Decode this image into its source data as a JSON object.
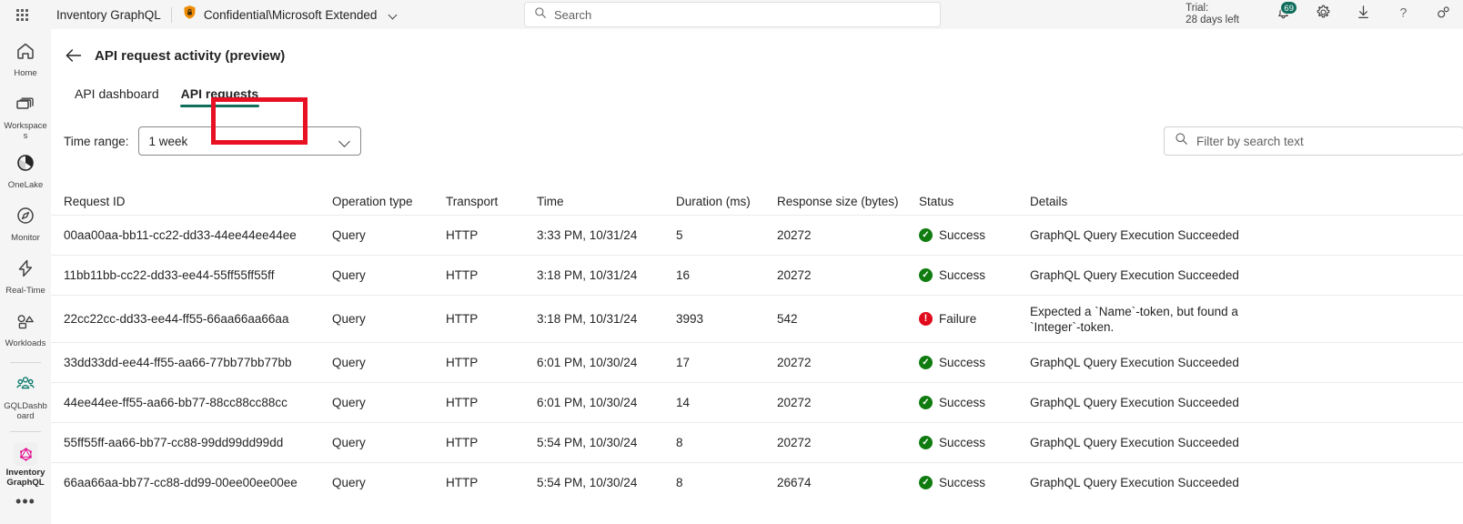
{
  "suitebar": {
    "waffle_label": "App launcher",
    "product_title": "Inventory GraphQL",
    "sensitivity_label": "Confidential\\Microsoft Extended",
    "search_placeholder": "Search",
    "search_value": "",
    "trial_line1": "Trial:",
    "trial_line2": "28 days left",
    "notification_badge": "69",
    "icons": {
      "waffle": "app-launcher-icon",
      "sensitivity": "shield-lock-icon",
      "search": "search-icon",
      "notifications": "notification-bell-icon",
      "settings": "gear-icon",
      "downloads": "download-icon",
      "help": "help-icon",
      "feedback": "feedback-icon"
    }
  },
  "rail": {
    "items": [
      {
        "label": "Home",
        "icon": "home-icon",
        "active": false
      },
      {
        "label": "Workspaces",
        "icon": "workspaces-icon",
        "active": false
      },
      {
        "label": "OneLake",
        "icon": "onelake-icon",
        "active": false
      },
      {
        "label": "Monitor",
        "icon": "monitor-icon",
        "active": false
      },
      {
        "label": "Real-Time",
        "icon": "real-time-icon",
        "active": false
      },
      {
        "label": "Workloads",
        "icon": "workloads-icon",
        "active": false
      },
      {
        "label": "GQLDashboard",
        "icon": "people-group-icon",
        "active": false
      },
      {
        "label": "Inventory GraphQL",
        "icon": "graphql-icon",
        "active": true
      }
    ],
    "more_label": "•••"
  },
  "page": {
    "back_label": "Back",
    "title": "API request activity (preview)",
    "tabs": [
      {
        "label": "API dashboard",
        "selected": false
      },
      {
        "label": "API requests",
        "selected": true
      }
    ],
    "annotation_color": "#e81123",
    "accent_color": "#0f6e5c"
  },
  "filters": {
    "time_range_label": "Time range:",
    "time_range_value": "1 week",
    "filter_placeholder": "Filter by search text",
    "filter_value": ""
  },
  "table": {
    "columns": [
      "Request ID",
      "Operation type",
      "Transport",
      "Time",
      "Duration (ms)",
      "Response size (bytes)",
      "Status",
      "Details"
    ],
    "rows": [
      {
        "request_id": "00aa00aa-bb11-cc22-dd33-44ee44ee44ee",
        "operation_type": "Query",
        "transport": "HTTP",
        "time": "3:33 PM, 10/31/24",
        "duration": "5",
        "response_size": "20272",
        "status": "Success",
        "status_kind": "success",
        "details": "GraphQL Query Execution Succeeded"
      },
      {
        "request_id": "11bb11bb-cc22-dd33-ee44-55ff55ff55ff",
        "operation_type": "Query",
        "transport": "HTTP",
        "time": "3:18 PM, 10/31/24",
        "duration": "16",
        "response_size": "20272",
        "status": "Success",
        "status_kind": "success",
        "details": "GraphQL Query Execution Succeeded"
      },
      {
        "request_id": "22cc22cc-dd33-ee44-ff55-66aa66aa66aa",
        "operation_type": "Query",
        "transport": "HTTP",
        "time": "3:18 PM, 10/31/24",
        "duration": "3993",
        "response_size": "542",
        "status": "Failure",
        "status_kind": "failure",
        "details": "Expected a `Name`-token, but found a `Integer`-token."
      },
      {
        "request_id": "33dd33dd-ee44-ff55-aa66-77bb77bb77bb",
        "operation_type": "Query",
        "transport": "HTTP",
        "time": "6:01 PM, 10/30/24",
        "duration": "17",
        "response_size": "20272",
        "status": "Success",
        "status_kind": "success",
        "details": "GraphQL Query Execution Succeeded"
      },
      {
        "request_id": "44ee44ee-ff55-aa66-bb77-88cc88cc88cc",
        "operation_type": "Query",
        "transport": "HTTP",
        "time": "6:01 PM, 10/30/24",
        "duration": "14",
        "response_size": "20272",
        "status": "Success",
        "status_kind": "success",
        "details": "GraphQL Query Execution Succeeded"
      },
      {
        "request_id": "55ff55ff-aa66-bb77-cc88-99dd99dd99dd",
        "operation_type": "Query",
        "transport": "HTTP",
        "time": "5:54 PM, 10/30/24",
        "duration": "8",
        "response_size": "20272",
        "status": "Success",
        "status_kind": "success",
        "details": "GraphQL Query Execution Succeeded"
      },
      {
        "request_id": "66aa66aa-bb77-cc88-dd99-00ee00ee00ee",
        "operation_type": "Query",
        "transport": "HTTP",
        "time": "5:54 PM, 10/30/24",
        "duration": "8",
        "response_size": "26674",
        "status": "Success",
        "status_kind": "success",
        "details": "GraphQL Query Execution Succeeded"
      }
    ]
  }
}
